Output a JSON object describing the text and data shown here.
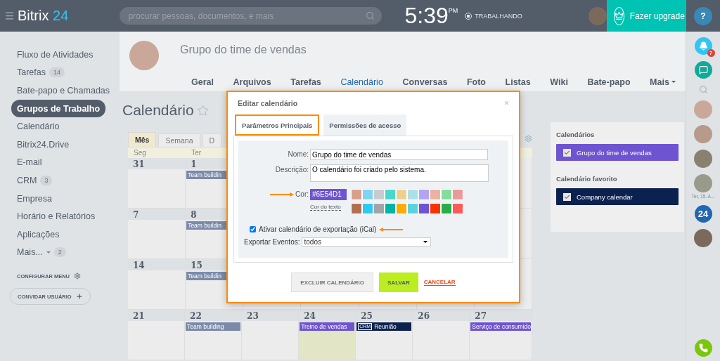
{
  "header": {
    "logo": "Bitrix",
    "logo_accent": "24",
    "search": {
      "placeholder": "procurar pessoas, documentos, e mais"
    },
    "time": "5:39",
    "meridiem": "PM",
    "status": "TRABALHANDO",
    "upgrade": "Fazer upgrade",
    "help": "?"
  },
  "sidebar": {
    "items": [
      {
        "label": "Fluxo de Atividades",
        "selected": false
      },
      {
        "label": "Tarefas",
        "badge": "14",
        "selected": false
      },
      {
        "label": "Bate-papo e Chamadas",
        "selected": false
      },
      {
        "label": "Grupos de Trabalho",
        "selected": true
      },
      {
        "label": "Calendário",
        "selected": false
      },
      {
        "label": "Bitrix24.Drive",
        "selected": false
      },
      {
        "label": "E-mail",
        "selected": false
      },
      {
        "label": "CRM",
        "badge": "3",
        "selected": false
      },
      {
        "label": "Empresa",
        "selected": false
      },
      {
        "label": "Horário e Relatórios",
        "selected": false
      },
      {
        "label": "Aplicações",
        "selected": false
      },
      {
        "label": "Mais...",
        "badge": "2",
        "dropdown": true,
        "selected": false
      }
    ],
    "configure": "CONFIGURAR MENU",
    "invite": "CONVIDAR USUÁRIO"
  },
  "group": {
    "title": "Grupo do time de vendas",
    "tabs": [
      {
        "label": "Geral",
        "selected": false
      },
      {
        "label": "Arquivos",
        "selected": false
      },
      {
        "label": "Tarefas",
        "selected": false
      },
      {
        "label": "Calendário",
        "selected": true
      },
      {
        "label": "Conversas",
        "selected": false
      },
      {
        "label": "Foto",
        "selected": false
      },
      {
        "label": "Listas",
        "selected": false
      },
      {
        "label": "Wiki",
        "selected": false
      },
      {
        "label": "Bate-papo",
        "selected": false
      },
      {
        "label": "Mais",
        "dropdown": true,
        "selected": false
      }
    ]
  },
  "page_title": "Calendário",
  "calendar": {
    "views": [
      {
        "label": "Mês",
        "selected": true
      },
      {
        "label": "Semana",
        "selected": false
      },
      {
        "label": "D",
        "selected": false
      }
    ],
    "weekdays": [
      "Seg",
      "Ter"
    ],
    "weeks": [
      {
        "days": [
          {
            "number": "31"
          },
          {
            "number": "1",
            "events": [
              {
                "title": "Team buildin",
                "color": "#7a8aa8"
              }
            ]
          }
        ]
      },
      {
        "days": [
          {
            "number": "7"
          },
          {
            "number": "8",
            "events": [
              {
                "title": "Team buildin",
                "color": "#7a8aa8"
              }
            ]
          }
        ]
      },
      {
        "days": [
          {
            "number": "14"
          },
          {
            "number": "15",
            "events": [
              {
                "title": "Team buildin",
                "color": "#7a8aa8"
              }
            ]
          }
        ]
      },
      {
        "days": [
          {
            "number": "21"
          },
          {
            "number": "22",
            "events": [
              {
                "title": "Team building",
                "color": "#7a8aa8"
              }
            ]
          },
          {
            "number": "23"
          },
          {
            "number": "24",
            "today": true,
            "events": [
              {
                "title": "Treino de vendas",
                "color": "#6e54d1"
              }
            ]
          },
          {
            "number": "25",
            "events": [
              {
                "title": "Reunião",
                "tag": "CRM",
                "color": "#0b2150"
              }
            ]
          },
          {
            "number": "26"
          },
          {
            "number": "27",
            "events": [
              {
                "title": "Serviço de consumido",
                "color": "#6e54d1"
              }
            ]
          }
        ]
      }
    ]
  },
  "side_panel": {
    "sections": [
      {
        "title": "Calendários",
        "items": [
          {
            "label": "Grupo do time de vendas",
            "color": "#6e54d1",
            "checked": true
          }
        ]
      },
      {
        "title": "Calendário favorito",
        "items": [
          {
            "label": "Company calendar",
            "color": "#0b2150",
            "checked": true
          }
        ]
      }
    ]
  },
  "right_bar": {
    "notifications": "7",
    "date": "Ter, 15. A...",
    "logo": "24"
  },
  "dialog": {
    "title": "Editar calendário",
    "close": "×",
    "tabs": [
      {
        "label": "Parâmetros Principais",
        "selected": true
      },
      {
        "label": "Permissões de acesso",
        "selected": false
      }
    ],
    "name_label": "Nome:",
    "name_value": "Grupo do time de vendas",
    "description_label": "Descrição:",
    "description_value": "O calendário foi criado pelo sistema.",
    "color_label": "Cor:",
    "color_value": "#6E54D1",
    "color": "#6e54d1",
    "text_color_link": "Cor do texto",
    "swatches": [
      [
        {
          "color": "#d8a08a"
        },
        {
          "color": "#7fd4ef"
        },
        {
          "color": "#c8ccd1"
        },
        {
          "color": "#47d9cc"
        },
        {
          "color": "#ecd18e"
        },
        {
          "color": "#addfe8"
        },
        {
          "color": "#b4a5f2"
        },
        {
          "color": "#edb1a0"
        },
        {
          "color": "#84dd9a"
        },
        {
          "color": "#eb9a9a"
        }
      ],
      [
        {
          "color": "#b36f52"
        },
        {
          "color": "#2ec9f3"
        },
        {
          "color": "#a2a5a8"
        },
        {
          "color": "#00b4a6"
        },
        {
          "color": "#ffaa00"
        },
        {
          "color": "#5bd0df"
        },
        {
          "color": "#6e54d1"
        },
        {
          "color": "#f93304"
        },
        {
          "color": "#29ad49"
        },
        {
          "color": "#fe5957"
        }
      ]
    ],
    "export_label": "Ativar calendário de exportação (iCal)",
    "export_checked": true,
    "export_events_label": "Exportar Eventos:",
    "export_events_value": "todos",
    "buttons": {
      "delete": "EXCLUIR CALENDÁRIO",
      "save": "SALVAR",
      "cancel": "CANCELAR"
    }
  }
}
